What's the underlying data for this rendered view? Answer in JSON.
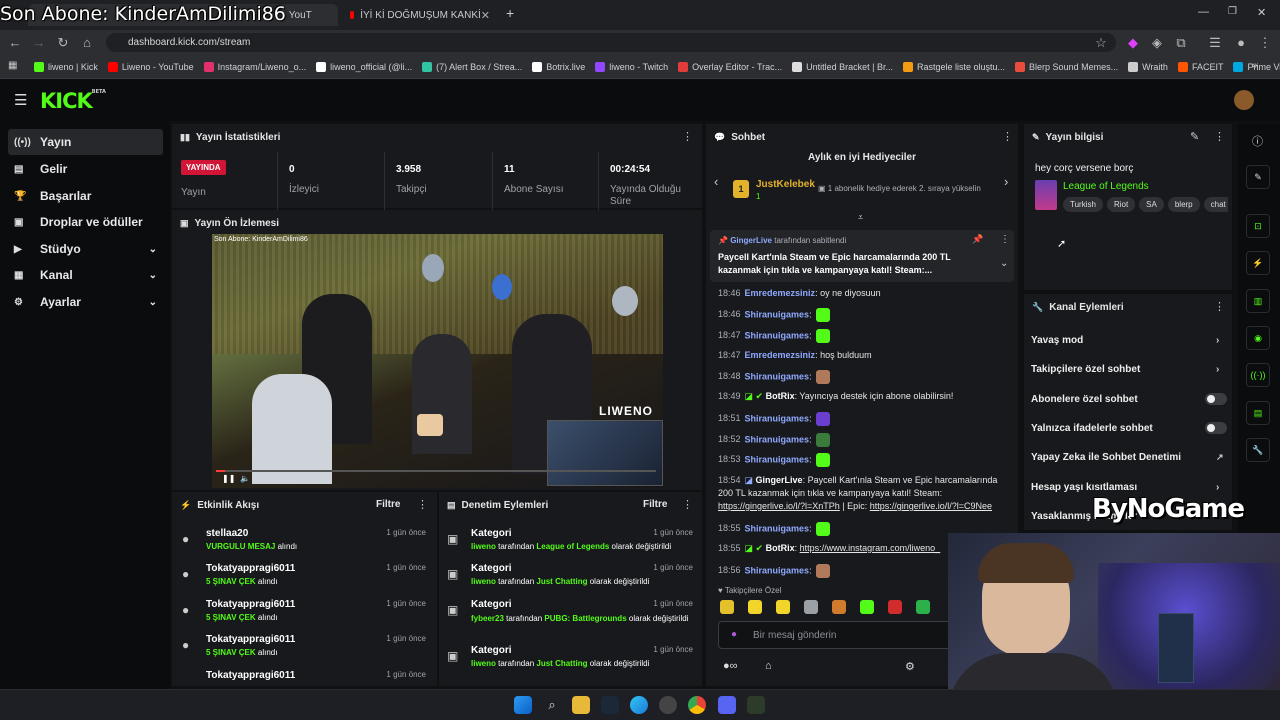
{
  "overlay": {
    "title": "Son Abone: KinderAmDilimi86",
    "watermark": "ByNoGame"
  },
  "browser": {
    "tabs": [
      {
        "label": "İYİ Kİ DOĞMUŞUM KANKİ",
        "active": false
      },
      {
        "label": "YouT",
        "active": false
      }
    ],
    "url": "dashboard.kick.com/stream",
    "bookmarks": [
      {
        "label": "liweno | Kick",
        "color": "#53fc18"
      },
      {
        "label": "Liweno - YouTube",
        "color": "#ff0000"
      },
      {
        "label": "Instagram/Liweno_o...",
        "color": "#e1306c"
      },
      {
        "label": "liweno_official (@li...",
        "color": "#ffffff"
      },
      {
        "label": "(7) Alert Box / Strea...",
        "color": "#31c3a2"
      },
      {
        "label": "Botrix.live",
        "color": "#ffffff"
      },
      {
        "label": "liweno - Twitch",
        "color": "#9146ff"
      },
      {
        "label": "Overlay Editor - Trac...",
        "color": "#e33b3b"
      },
      {
        "label": "Untitled Bracket | Br...",
        "color": "#dddddd"
      },
      {
        "label": "Rastgele liste oluştu...",
        "color": "#f39c12"
      },
      {
        "label": "Blerp Sound Memes...",
        "color": "#e74c3c"
      },
      {
        "label": "Wraith",
        "color": "#cccccc"
      },
      {
        "label": "FACEIT",
        "color": "#ff5500"
      },
      {
        "label": "Prime Video",
        "color": "#00a8e1"
      }
    ]
  },
  "site": {
    "logo": "KICK",
    "logo_beta": "BETA"
  },
  "sidebar": {
    "items": [
      {
        "label": "Yayın",
        "icon": "broadcast-icon",
        "glyph": "((•))",
        "active": true,
        "expandable": false
      },
      {
        "label": "Gelir",
        "icon": "revenue-icon",
        "glyph": "▤",
        "active": false,
        "expandable": false
      },
      {
        "label": "Başarılar",
        "icon": "trophy-icon",
        "glyph": "🏆",
        "active": false,
        "expandable": false
      },
      {
        "label": "Droplar ve ödüller",
        "icon": "gift-icon",
        "glyph": "▣",
        "active": false,
        "expandable": false
      },
      {
        "label": "Stüdyo",
        "icon": "studio-icon",
        "glyph": "▶",
        "active": false,
        "expandable": true
      },
      {
        "label": "Kanal",
        "icon": "channel-icon",
        "glyph": "▦",
        "active": false,
        "expandable": true
      },
      {
        "label": "Ayarlar",
        "icon": "settings-icon",
        "glyph": "⚙",
        "active": false,
        "expandable": true
      }
    ]
  },
  "stats": {
    "title": "Yayın İstatistikleri",
    "status_badge": "YAYINDA",
    "status_label": "Yayın",
    "items": [
      {
        "value": "0",
        "label": "İzleyici"
      },
      {
        "value": "3.958",
        "label": "Takipçi"
      },
      {
        "value": "11",
        "label": "Abone Sayısı"
      },
      {
        "value": "00:24:54",
        "label": "Yayında Olduğu Süre"
      }
    ]
  },
  "preview": {
    "title": "Yayın Ön İzlemesi",
    "stream_overlay": "Son Abone: KinderAmDilimi86",
    "stream_brand": "LIWENO",
    "progress": 0.02
  },
  "activity": {
    "title": "Etkinlik Akışı",
    "filter": "Filtre",
    "items": [
      {
        "name": "stellaa20",
        "what": "VURGULU MESAJ",
        "suffix": "alındı",
        "time": "1 gün önce"
      },
      {
        "name": "Tokatyappragi6011",
        "what": "5 ŞINAV ÇEK",
        "suffix": "alındı",
        "time": "1 gün önce"
      },
      {
        "name": "Tokatyappragi6011",
        "what": "5 ŞINAV ÇEK",
        "suffix": "alındı",
        "time": "1 gün önce"
      },
      {
        "name": "Tokatyappragi6011",
        "what": "5 ŞINAV ÇEK",
        "suffix": "alındı",
        "time": "1 gün önce"
      },
      {
        "name": "Tokatyappragi6011",
        "what": "",
        "suffix": "",
        "time": "1 gün önce"
      }
    ]
  },
  "moderation": {
    "title": "Denetim Eylemleri",
    "filter": "Filtre",
    "items": [
      {
        "title": "Kategori",
        "user": "liweno",
        "mid": "tarafından",
        "cat": "League of Legends",
        "end": "olarak değiştirildi",
        "time": "1 gün önce"
      },
      {
        "title": "Kategori",
        "user": "liweno",
        "mid": "tarafından",
        "cat": "Just Chatting",
        "end": "olarak değiştirildi",
        "time": "1 gün önce"
      },
      {
        "title": "Kategori",
        "user": "fybeer23",
        "mid": "tarafından",
        "cat": "PUBG: Battlegrounds",
        "end": "olarak değiştirildi",
        "time": "1 gün önce"
      },
      {
        "title": "Kategori",
        "user": "liweno",
        "mid": "tarafından",
        "cat": "Just Chatting",
        "end": "olarak değiştirildi",
        "time": "1 gün önce"
      }
    ]
  },
  "chat": {
    "title": "Sohbet",
    "gifters_title": "Aylık en iyi Hediyeciler",
    "gifter_rank": "1",
    "gifter_name": "JustKelebek",
    "gifter_count": "1",
    "gifter_note": "1 abonelik hediye ederek 2. sıraya yükselin",
    "pinned_by": "GingerLive",
    "pinned_by_suffix": "tarafından sabitlendi",
    "pinned_text": "Paycell Kart'ınla Steam ve Epic harcamalarında 200 TL kazanmak için tıkla ve kampanyaya katıl! Steam:...",
    "messages": [
      {
        "time": "18:46",
        "user": "Emredemezsiniz",
        "style": "blue",
        "text": "oy ne diyosuun",
        "emote": ""
      },
      {
        "time": "18:46",
        "user": "Shiranuigames",
        "style": "blue",
        "text": "",
        "emote": "#53fc18"
      },
      {
        "time": "18:47",
        "user": "Shiranuigames",
        "style": "blue",
        "text": "",
        "emote": "#53fc18"
      },
      {
        "time": "18:47",
        "user": "Emredemezsiniz",
        "style": "blue",
        "text": "hoş bulduum",
        "emote": ""
      },
      {
        "time": "18:48",
        "user": "Shiranuigames",
        "style": "blue",
        "text": "",
        "emote": "#b07a5a"
      },
      {
        "time": "18:49",
        "user": "BotRix",
        "style": "white",
        "text": "Yayıncıya destek için abone olabilirsin!",
        "emote": ""
      },
      {
        "time": "18:51",
        "user": "Shiranuigames",
        "style": "blue",
        "text": "",
        "emote": "#6a3fd0"
      },
      {
        "time": "18:52",
        "user": "Shiranuigames",
        "style": "blue",
        "text": "",
        "emote": "#3a7a3a"
      },
      {
        "time": "18:53",
        "user": "Shiranuigames",
        "style": "blue",
        "text": "",
        "emote": "#53fc18"
      }
    ],
    "ginger_time": "18:54",
    "ginger_user": "GingerLive",
    "ginger_text": "Paycell Kart'ınla Steam ve Epic harcamalarında",
    "ginger_text2": "200 TL kazanmak için tıkla ve kampanyaya katıl! Steam:",
    "ginger_link1": "https://gingerlive.io/l/?l=XnTPh",
    "ginger_sep": "| Epic:",
    "ginger_link2": "https://gingerlive.io/l/?l=C9Nee",
    "after": [
      {
        "time": "18:55",
        "user": "Shiranuigames",
        "text": "",
        "emote": "#53fc18"
      }
    ],
    "botrix2_time": "18:55",
    "botrix2_user": "BotRix",
    "botrix2_link": "https://www.instagram.com/liweno_",
    "last_time": "18:56",
    "last_user": "Shiranuigames",
    "emote_bar_label": "Takipçilere Özel",
    "input_placeholder": "Bir mesaj gönderin"
  },
  "stream_info": {
    "title": "Yayın bilgisi",
    "stream_title": "hey corç versene borç",
    "category": "League of Legends",
    "tags": [
      "Turkish",
      "Riot",
      "SA",
      "blerp",
      "chat"
    ]
  },
  "channel_actions": {
    "title": "Kanal Eylemleri",
    "items": [
      {
        "label": "Yavaş mod",
        "control": "chevron"
      },
      {
        "label": "Takipçilere özel sohbet",
        "control": "chevron"
      },
      {
        "label": "Abonelere özel sohbet",
        "control": "toggle"
      },
      {
        "label": "Yalnızca ifadelerle sohbet",
        "control": "toggle"
      },
      {
        "label": "Yapay Zeka ile Sohbet Denetimi",
        "control": "external"
      },
      {
        "label": "Hesap yaşı kısıtlaması",
        "control": "chevron"
      },
      {
        "label": "Yasaklanmış kelimeler",
        "control": "chevron"
      }
    ]
  }
}
